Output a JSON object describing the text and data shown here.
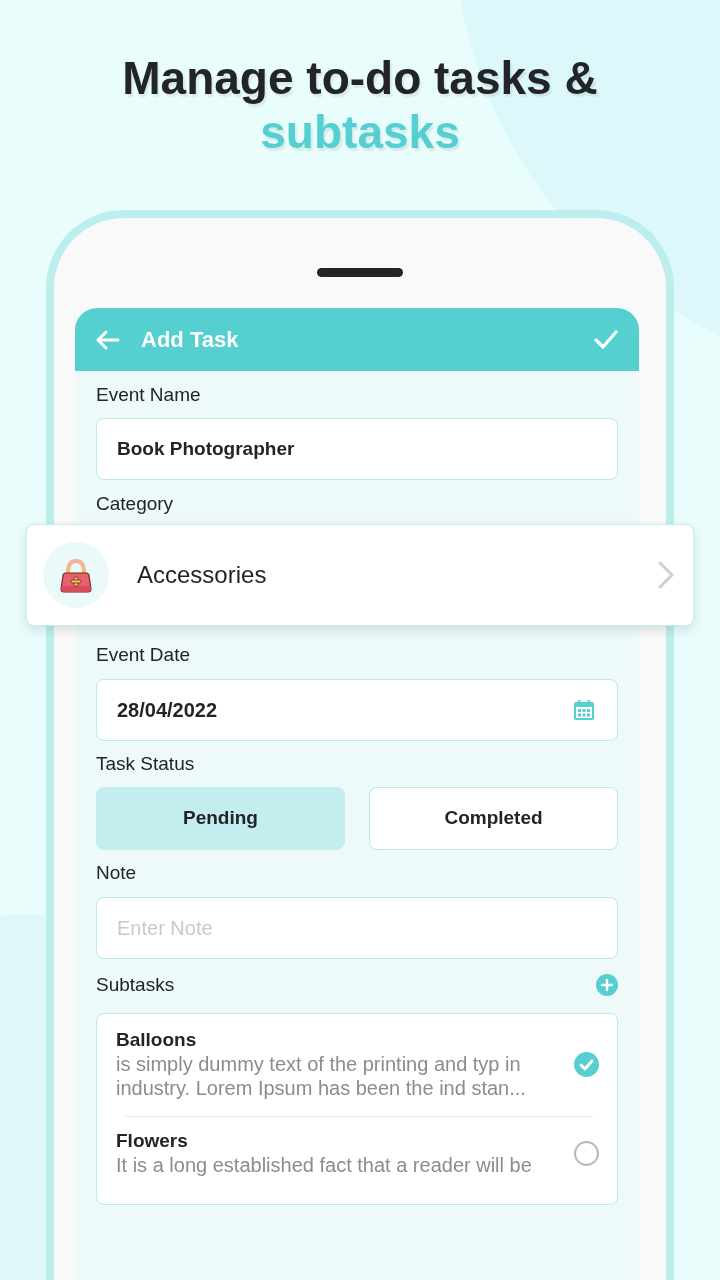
{
  "headline": {
    "text": "Manage to-do tasks &",
    "highlight": "subtasks"
  },
  "app_bar": {
    "title": "Add Task"
  },
  "form": {
    "event_name": {
      "label": "Event Name",
      "value": "Book Photographer"
    },
    "category": {
      "label": "Category",
      "value": "Accessories"
    },
    "event_date": {
      "label": "Event Date",
      "value": "28/04/2022"
    },
    "task_status": {
      "label": "Task Status",
      "options": [
        {
          "label": "Pending",
          "selected": true
        },
        {
          "label": "Completed",
          "selected": false
        }
      ]
    },
    "note": {
      "label": "Note",
      "placeholder": "Enter Note"
    },
    "subtasks": {
      "label": "Subtasks",
      "items": [
        {
          "title": "Balloons",
          "description": "is simply dummy text of the printing and typ in industry. Lorem Ipsum has been the ind stan...",
          "checked": true
        },
        {
          "title": "Flowers",
          "description": "It is a long established fact that a reader will be",
          "checked": false
        }
      ]
    }
  }
}
